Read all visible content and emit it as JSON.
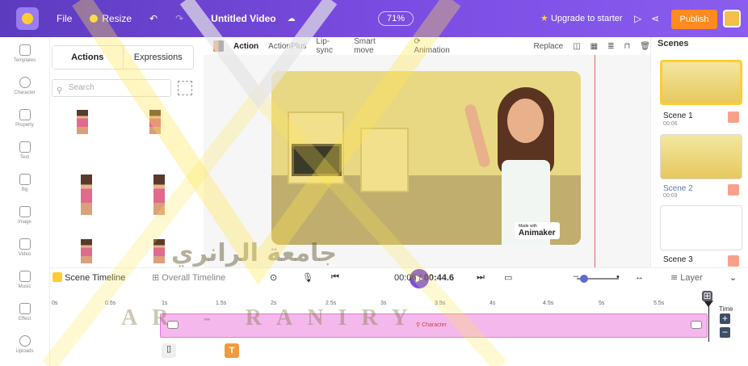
{
  "topbar": {
    "menu": [
      "File",
      "Resize"
    ],
    "project_title": "Untitled Video",
    "zoom": "71%",
    "upgrade": "Upgrade to starter",
    "publish": "Publish"
  },
  "leftnav": {
    "items": [
      "Templates",
      "Character",
      "Property",
      "Text",
      "Bg",
      "Image",
      "Video",
      "Music",
      "Effect",
      "Uploads"
    ]
  },
  "panel": {
    "tabs": [
      "Actions",
      "Expressions"
    ],
    "search_placeholder": "Search"
  },
  "canvas_toolbar": {
    "items": [
      "Action",
      "ActionPlus",
      "Lip-sync",
      "Smart move",
      "Animation"
    ],
    "replace": "Replace"
  },
  "stage": {
    "brand_small": "Made with",
    "brand": "Animaker"
  },
  "scenes": {
    "title": "Scenes",
    "list": [
      {
        "name": "Scene 1",
        "time": "00:06"
      },
      {
        "name": "Scene 2",
        "time": "00:03"
      },
      {
        "name": "Scene 3",
        "time": ""
      }
    ]
  },
  "timeline": {
    "scene_timeline": "Scene Timeline",
    "overall_timeline": "Overall Timeline",
    "current_time": "00:06",
    "separator": "/",
    "total_time": "00:44.6",
    "layer": "Layer",
    "time_label": "Time",
    "ruler": [
      "0s",
      "0.5s",
      "1s",
      "1.5s",
      "2s",
      "2.5s",
      "3s",
      "3.5s",
      "4s",
      "4.5s",
      "5s",
      "5.5s"
    ],
    "track_label": "Character",
    "zoom_level": 0.25
  },
  "watermark": {
    "arabic": "جامعة الرانري",
    "latin": "AR - RANIRY"
  },
  "colors": {
    "topbar": "#6a43d6",
    "publish": "#ff8a1f",
    "track": "#f4b8ec",
    "accent": "#7a4be0"
  }
}
